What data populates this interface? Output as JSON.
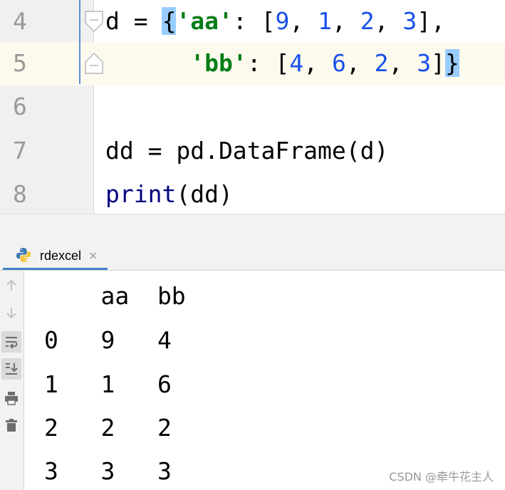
{
  "editor": {
    "lines": [
      {
        "number": "4",
        "text": "d = {'aa': [9, 1, 2, 3],"
      },
      {
        "number": "5",
        "text": "      'bb': [4, 6, 2, 3]}"
      },
      {
        "number": "6",
        "text": ""
      },
      {
        "number": "7",
        "text": "dd = pd.DataFrame(d)"
      },
      {
        "number": "8",
        "text": "print(dd)"
      }
    ],
    "current_line": "5"
  },
  "run_panel": {
    "tab": {
      "label": "rdexcel",
      "icon": "python-icon",
      "close": "×"
    },
    "toolbar": [
      {
        "icon": "arrow-up-icon"
      },
      {
        "icon": "arrow-down-icon"
      },
      {
        "icon": "soft-wrap-icon"
      },
      {
        "icon": "scroll-to-end-icon"
      },
      {
        "icon": "print-icon"
      },
      {
        "icon": "trash-icon"
      }
    ],
    "output": [
      "    aa  bb",
      "0   9   4",
      "1   1   6",
      "2   2   2",
      "3   3   3"
    ]
  },
  "watermark": "CSDN @牵牛花主人",
  "colors": {
    "string": "#067d17",
    "number": "#1750eb",
    "builtin": "#000080",
    "brace_highlight": "#99ccff",
    "current_line": "#fcfaed",
    "tab_underline": "#4083c9"
  }
}
